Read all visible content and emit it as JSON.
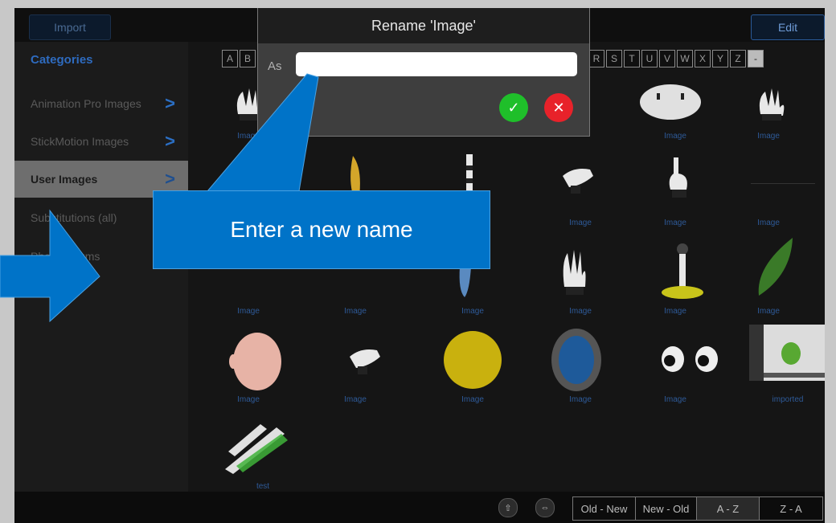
{
  "toolbar": {
    "import_label": "Import",
    "edit_label": "Edit"
  },
  "sidebar": {
    "heading": "Categories",
    "items": [
      {
        "label": "Animation Pro Images",
        "chevron": ">"
      },
      {
        "label": "StickMotion Images",
        "chevron": ">"
      },
      {
        "label": "User Images",
        "chevron": ">"
      },
      {
        "label": "Substitutions (all)"
      },
      {
        "label": "Photo Albums"
      }
    ]
  },
  "alphabet": {
    "left": [
      "A",
      "B"
    ],
    "right": [
      "R",
      "S",
      "T",
      "U",
      "V",
      "W",
      "X",
      "Y",
      "Z",
      "-"
    ]
  },
  "grid": {
    "labels": [
      "Image",
      "Image",
      "Image",
      "Image",
      "Image",
      "Image",
      "Image",
      "Image",
      "Image",
      "Image",
      "Image",
      "Image",
      "Image",
      "Image",
      "Image",
      "Image",
      "Image",
      "imported",
      "test"
    ]
  },
  "dialog": {
    "title": "Rename 'Image'",
    "as_label": "As",
    "input_value": "",
    "ok_symbol": "✓",
    "cancel_symbol": "✕"
  },
  "callout": {
    "text": "Enter a new name"
  },
  "bottom": {
    "sort_options": [
      "Old - New",
      "New - Old",
      "A - Z",
      "Z - A"
    ]
  },
  "colors": {
    "accent": "#0073c8",
    "ok": "#1fbf2a",
    "cancel": "#e8222a"
  }
}
